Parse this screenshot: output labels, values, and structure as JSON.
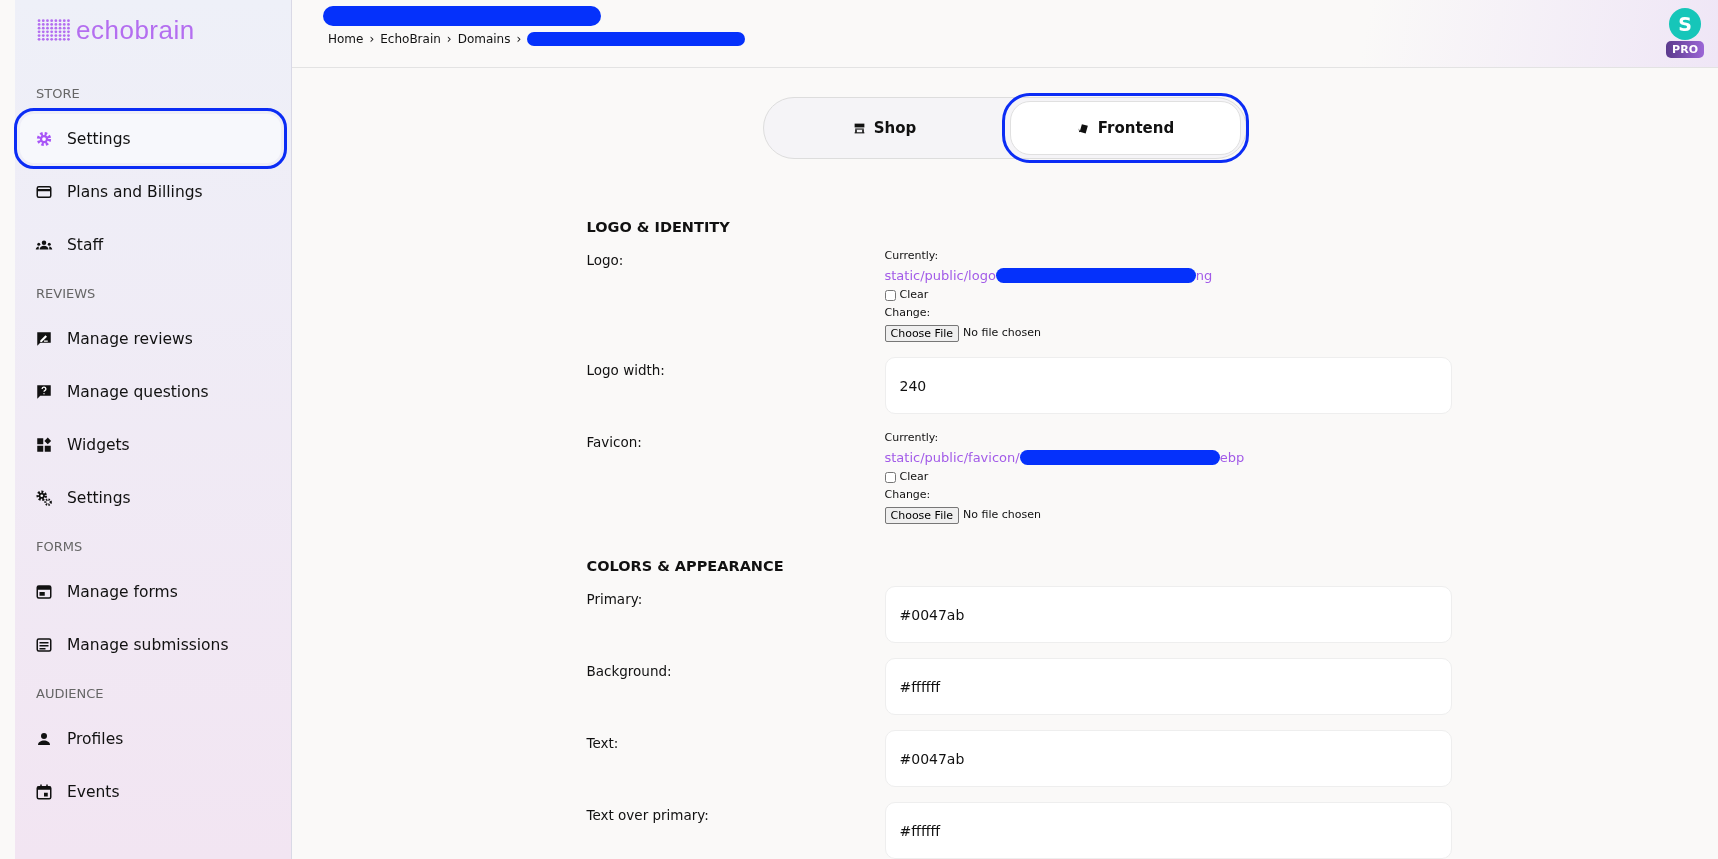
{
  "brand": {
    "name": "echobrain"
  },
  "sidebar": {
    "sections": [
      {
        "heading": "STORE",
        "items": [
          {
            "label": "Settings",
            "selected": true,
            "highlighted": true
          },
          {
            "label": "Plans and Billings",
            "selected": false,
            "highlighted": false
          },
          {
            "label": "Staff",
            "selected": false,
            "highlighted": false
          }
        ]
      },
      {
        "heading": "REVIEWS",
        "items": [
          {
            "label": "Manage reviews",
            "selected": false,
            "highlighted": false
          },
          {
            "label": "Manage questions",
            "selected": false,
            "highlighted": false
          },
          {
            "label": "Widgets",
            "selected": false,
            "highlighted": false
          },
          {
            "label": "Settings",
            "selected": false,
            "highlighted": false
          }
        ]
      },
      {
        "heading": "FORMS",
        "items": [
          {
            "label": "Manage forms",
            "selected": false,
            "highlighted": false
          },
          {
            "label": "Manage submissions",
            "selected": false,
            "highlighted": false
          }
        ]
      },
      {
        "heading": "AUDIENCE",
        "items": [
          {
            "label": "Profiles",
            "selected": false,
            "highlighted": false
          },
          {
            "label": "Events",
            "selected": false,
            "highlighted": false
          }
        ]
      }
    ]
  },
  "header": {
    "breadcrumbs": [
      {
        "label": "Home"
      },
      {
        "label": "EchoBrain"
      },
      {
        "label": "Domains"
      }
    ],
    "separator": "›"
  },
  "avatar": {
    "initial": "S",
    "badge": "PRO"
  },
  "tabs": [
    {
      "label": "Shop",
      "selected": false,
      "highlighted": false
    },
    {
      "label": "Frontend",
      "selected": true,
      "highlighted": true
    }
  ],
  "sections": [
    {
      "heading": "LOGO & IDENTITY",
      "fields": [
        {
          "kind": "file",
          "label": "Logo:",
          "currently_label": "Currently:",
          "path_start": "static/public/logo",
          "path_end": "ng",
          "clear_label": "Clear",
          "clear_checked": false,
          "change_label": "Change:",
          "button": "Choose File",
          "file_status": "No file chosen"
        },
        {
          "kind": "text",
          "label": "Logo width:",
          "value": "240"
        },
        {
          "kind": "file",
          "label": "Favicon:",
          "currently_label": "Currently:",
          "path_start": "static/public/favicon/",
          "path_end": "ebp",
          "clear_label": "Clear",
          "clear_checked": false,
          "change_label": "Change:",
          "button": "Choose File",
          "file_status": "No file chosen"
        }
      ]
    },
    {
      "heading": "COLORS & APPEARANCE",
      "fields": [
        {
          "kind": "text",
          "label": "Primary:",
          "value": "#0047ab"
        },
        {
          "kind": "text",
          "label": "Background:",
          "value": "#ffffff"
        },
        {
          "kind": "text",
          "label": "Text:",
          "value": "#0047ab"
        },
        {
          "kind": "text",
          "label": "Text over primary:",
          "value": "#ffffff"
        }
      ]
    }
  ]
}
